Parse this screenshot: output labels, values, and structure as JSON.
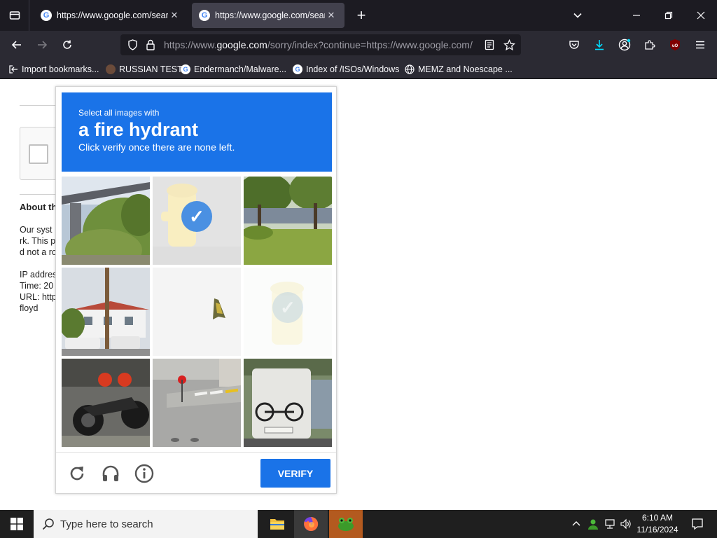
{
  "browser": {
    "tabs": [
      {
        "title": "https://www.google.com/searc",
        "active": false
      },
      {
        "title": "https://www.google.com/searc",
        "active": true
      }
    ],
    "url_prefix": "https://www.",
    "url_host": "google.com",
    "url_rest": "/sorry/index?continue=https://www.google.com/",
    "bookmarks": [
      {
        "label": "Import bookmarks...",
        "icon": "import-icon"
      },
      {
        "label": "RUSSIAN TEST",
        "icon": "site-icon"
      },
      {
        "label": "Endermanch/Malware...",
        "icon": "google-icon"
      },
      {
        "label": "Index of /ISOs/Windows",
        "icon": "google-icon"
      },
      {
        "label": "MEMZ and Noescape ...",
        "icon": "globe-icon"
      }
    ]
  },
  "page": {
    "about_heading": "About th",
    "body_lines": [
      "Our syst",
      "rk. This p",
      "d not a ro",
      "",
      "IP addres",
      "Time: 20",
      "URL: http",
      "floyd"
    ]
  },
  "captcha": {
    "instruction_small": "Select all images with",
    "target": "a fire hydrant",
    "instruction_sub": "Click verify once there are none left.",
    "verify_label": "VERIFY",
    "tiles": [
      {
        "scene": "bridge over greenery",
        "selected": false
      },
      {
        "scene": "fire hydrant",
        "selected": true
      },
      {
        "scene": "park with trees",
        "selected": false
      },
      {
        "scene": "house with utility pole",
        "selected": false
      },
      {
        "scene": "loading tile",
        "selected": false
      },
      {
        "scene": "fire hydrant",
        "selected": true
      },
      {
        "scene": "motorcycle",
        "selected": false
      },
      {
        "scene": "street crossing",
        "selected": false
      },
      {
        "scene": "camper van with bicycle",
        "selected": false
      }
    ]
  },
  "taskbar": {
    "search_placeholder": "Type here to search",
    "time": "6:10 AM",
    "date": "11/16/2024"
  },
  "colors": {
    "captcha_blue": "#1a73e8",
    "browser_dark": "#1c1b22",
    "toolbar": "#2b2a33",
    "check_blue": "#4a90e2"
  }
}
